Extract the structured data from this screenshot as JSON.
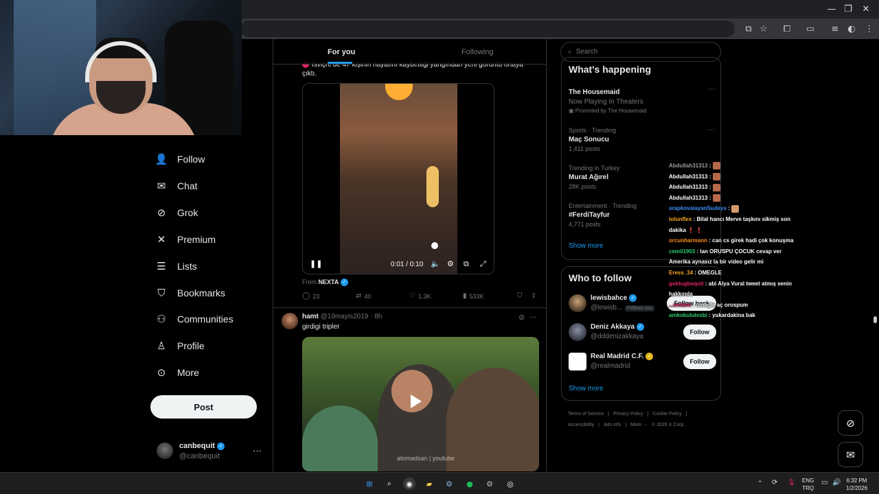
{
  "browser": {
    "window_controls": [
      "—",
      "❐",
      "✕"
    ],
    "toolbar_icons": [
      "screen-cast-icon",
      "star-icon",
      "extensions-icon",
      "split-view-icon",
      "reading-list-icon",
      "profile-icon",
      "menu-icon"
    ]
  },
  "nav": {
    "items": [
      {
        "label": "Follow",
        "icon": "add-person-icon"
      },
      {
        "label": "Chat",
        "icon": "mail-icon"
      },
      {
        "label": "Grok",
        "icon": "grok-icon"
      },
      {
        "label": "Premium",
        "icon": "x-logo-icon"
      },
      {
        "label": "Lists",
        "icon": "list-icon"
      },
      {
        "label": "Bookmarks",
        "icon": "bookmark-icon"
      },
      {
        "label": "Communities",
        "icon": "communities-icon"
      },
      {
        "label": "Profile",
        "icon": "person-icon"
      },
      {
        "label": "More",
        "icon": "more-circle-icon"
      }
    ],
    "post_label": "Post",
    "account": {
      "name": "canbequit",
      "handle": "@canbequit",
      "more": "···"
    }
  },
  "feed": {
    "tabs": [
      "For you",
      "Following"
    ],
    "tweet1": {
      "text": "İsviçre'de 47 kişinin hayatını kaybettiği yangından yeni görüntü ortaya çıktı.",
      "video_time": "0:01 / 0:10",
      "from_prefix": "From",
      "from_source": "NEXTA",
      "replies": "23",
      "reposts": "40",
      "likes": "1.3K",
      "views": "533K"
    },
    "tweet2": {
      "name": "hamt",
      "handle": "@19mayis2019",
      "time": "· 8h",
      "text": "girdigi tripler",
      "watermark": "atomadsan | youtube"
    }
  },
  "right": {
    "search_placeholder": "Search",
    "whats_happening_title": "What's happening",
    "trends": [
      {
        "meta": "",
        "name": "The Housemaid",
        "sub": "Now Playing In Theaters",
        "promo": "Promoted by The Housemaid"
      },
      {
        "meta": "Sports · Trending",
        "name": "Maç Sonucu",
        "sub": "1,411 posts",
        "promo": ""
      },
      {
        "meta": "Trending in Turkey",
        "name": "Murat Ağırel",
        "sub": "28K posts",
        "promo": ""
      },
      {
        "meta": "Entertainment · Trending",
        "name": "#FerdiTayfur",
        "sub": "4,771 posts",
        "promo": ""
      }
    ],
    "show_more": "Show more",
    "who_to_follow_title": "Who to follow",
    "who_to_follow": [
      {
        "name": "lewisbahce",
        "handle": "@lewisb...",
        "follows_you": "Follows you",
        "button": "Follow back",
        "badge": "blue"
      },
      {
        "name": "Deniz Akkaya",
        "handle": "@dddenizakkaya",
        "follows_you": "",
        "button": "Follow",
        "badge": "blue"
      },
      {
        "name": "Real Madrid C.F.",
        "handle": "@realmadrid",
        "follows_you": "",
        "button": "Follow",
        "badge": "gold"
      }
    ],
    "show_more_2": "Show more",
    "footer": [
      "Terms of Service",
      "|",
      "Privacy Policy",
      "|",
      "Cookie Policy",
      "|",
      "Accessibility",
      "|",
      "Ads info",
      "|",
      "More ···",
      "© 2026 X Corp."
    ]
  },
  "chat": [
    {
      "user": "Abdullah31313",
      "color": "#9b9b9b",
      "msg": ":"
    },
    {
      "user": "Abdullah31313",
      "color": "#ffffff",
      "msg": ":"
    },
    {
      "user": "Abdullah31313",
      "color": "#ffffff",
      "msg": ":"
    },
    {
      "user": "Abdullah31313",
      "color": "#ffffff",
      "msg": ":"
    },
    {
      "user": "arapkovalayanSudeys",
      "color": "#3d8df5",
      "msg": ":"
    },
    {
      "user": "tolunflex",
      "color": "#f5a623",
      "msg": ": Bilal hancı Merve taşkını sikmiş son dakika ❗ ❗"
    },
    {
      "user": "orcunharmann",
      "color": "#ff8c1a",
      "msg": ": can cs girek hadi çok konuşma"
    },
    {
      "user": "cemil1903",
      "color": "#2ecc71",
      "msg": ": lan ORUSPU ÇOCUK cevap ver Amerika aynasız la bir video gelir mi"
    },
    {
      "user": "Eress_34",
      "color": "#f5a623",
      "msg": ": OMEGLE"
    },
    {
      "user": "goktugbequit",
      "color": "#e0245e",
      "msg": ": abi Alya Vural tweet atmış senin hakkında"
    },
    {
      "user": "...eniden",
      "color": "#e0245e",
      "msg": ": omegle aç orospum"
    },
    {
      "user": "amkokulutesbi",
      "color": "#2ecc71",
      "msg": ": yukardakina bak"
    }
  ],
  "taskbar": {
    "apps": [
      "windows-icon",
      "search-icon",
      "chrome-icon",
      "folder-icon",
      "steam-icon",
      "spotify-icon",
      "settings-icon",
      "obs-icon"
    ],
    "lang_top": "ENG",
    "lang_bottom": "TRQ",
    "time": "6:32 PM",
    "date": "1/2/2026"
  }
}
